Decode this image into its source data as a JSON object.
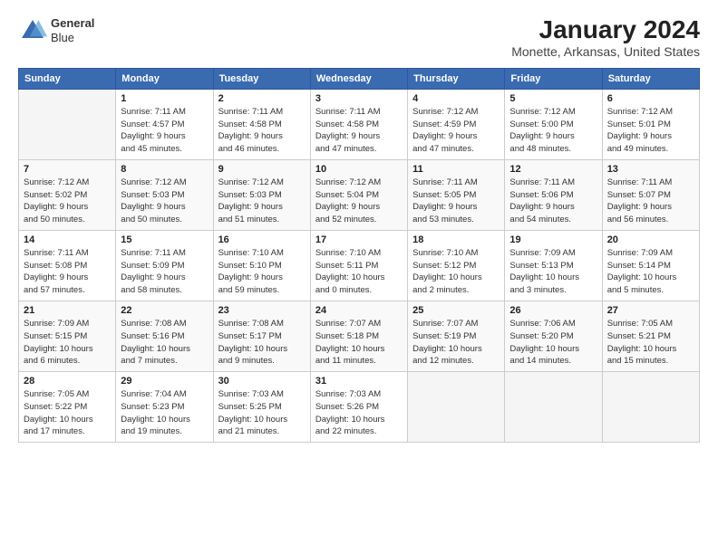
{
  "header": {
    "logo": {
      "line1": "General",
      "line2": "Blue"
    },
    "title": "January 2024",
    "subtitle": "Monette, Arkansas, United States"
  },
  "calendar": {
    "days_of_week": [
      "Sunday",
      "Monday",
      "Tuesday",
      "Wednesday",
      "Thursday",
      "Friday",
      "Saturday"
    ],
    "weeks": [
      [
        {
          "day": "",
          "info": ""
        },
        {
          "day": "1",
          "info": "Sunrise: 7:11 AM\nSunset: 4:57 PM\nDaylight: 9 hours\nand 45 minutes."
        },
        {
          "day": "2",
          "info": "Sunrise: 7:11 AM\nSunset: 4:58 PM\nDaylight: 9 hours\nand 46 minutes."
        },
        {
          "day": "3",
          "info": "Sunrise: 7:11 AM\nSunset: 4:58 PM\nDaylight: 9 hours\nand 47 minutes."
        },
        {
          "day": "4",
          "info": "Sunrise: 7:12 AM\nSunset: 4:59 PM\nDaylight: 9 hours\nand 47 minutes."
        },
        {
          "day": "5",
          "info": "Sunrise: 7:12 AM\nSunset: 5:00 PM\nDaylight: 9 hours\nand 48 minutes."
        },
        {
          "day": "6",
          "info": "Sunrise: 7:12 AM\nSunset: 5:01 PM\nDaylight: 9 hours\nand 49 minutes."
        }
      ],
      [
        {
          "day": "7",
          "info": "Sunrise: 7:12 AM\nSunset: 5:02 PM\nDaylight: 9 hours\nand 50 minutes."
        },
        {
          "day": "8",
          "info": "Sunrise: 7:12 AM\nSunset: 5:03 PM\nDaylight: 9 hours\nand 50 minutes."
        },
        {
          "day": "9",
          "info": "Sunrise: 7:12 AM\nSunset: 5:03 PM\nDaylight: 9 hours\nand 51 minutes."
        },
        {
          "day": "10",
          "info": "Sunrise: 7:12 AM\nSunset: 5:04 PM\nDaylight: 9 hours\nand 52 minutes."
        },
        {
          "day": "11",
          "info": "Sunrise: 7:11 AM\nSunset: 5:05 PM\nDaylight: 9 hours\nand 53 minutes."
        },
        {
          "day": "12",
          "info": "Sunrise: 7:11 AM\nSunset: 5:06 PM\nDaylight: 9 hours\nand 54 minutes."
        },
        {
          "day": "13",
          "info": "Sunrise: 7:11 AM\nSunset: 5:07 PM\nDaylight: 9 hours\nand 56 minutes."
        }
      ],
      [
        {
          "day": "14",
          "info": "Sunrise: 7:11 AM\nSunset: 5:08 PM\nDaylight: 9 hours\nand 57 minutes."
        },
        {
          "day": "15",
          "info": "Sunrise: 7:11 AM\nSunset: 5:09 PM\nDaylight: 9 hours\nand 58 minutes."
        },
        {
          "day": "16",
          "info": "Sunrise: 7:10 AM\nSunset: 5:10 PM\nDaylight: 9 hours\nand 59 minutes."
        },
        {
          "day": "17",
          "info": "Sunrise: 7:10 AM\nSunset: 5:11 PM\nDaylight: 10 hours\nand 0 minutes."
        },
        {
          "day": "18",
          "info": "Sunrise: 7:10 AM\nSunset: 5:12 PM\nDaylight: 10 hours\nand 2 minutes."
        },
        {
          "day": "19",
          "info": "Sunrise: 7:09 AM\nSunset: 5:13 PM\nDaylight: 10 hours\nand 3 minutes."
        },
        {
          "day": "20",
          "info": "Sunrise: 7:09 AM\nSunset: 5:14 PM\nDaylight: 10 hours\nand 5 minutes."
        }
      ],
      [
        {
          "day": "21",
          "info": "Sunrise: 7:09 AM\nSunset: 5:15 PM\nDaylight: 10 hours\nand 6 minutes."
        },
        {
          "day": "22",
          "info": "Sunrise: 7:08 AM\nSunset: 5:16 PM\nDaylight: 10 hours\nand 7 minutes."
        },
        {
          "day": "23",
          "info": "Sunrise: 7:08 AM\nSunset: 5:17 PM\nDaylight: 10 hours\nand 9 minutes."
        },
        {
          "day": "24",
          "info": "Sunrise: 7:07 AM\nSunset: 5:18 PM\nDaylight: 10 hours\nand 11 minutes."
        },
        {
          "day": "25",
          "info": "Sunrise: 7:07 AM\nSunset: 5:19 PM\nDaylight: 10 hours\nand 12 minutes."
        },
        {
          "day": "26",
          "info": "Sunrise: 7:06 AM\nSunset: 5:20 PM\nDaylight: 10 hours\nand 14 minutes."
        },
        {
          "day": "27",
          "info": "Sunrise: 7:05 AM\nSunset: 5:21 PM\nDaylight: 10 hours\nand 15 minutes."
        }
      ],
      [
        {
          "day": "28",
          "info": "Sunrise: 7:05 AM\nSunset: 5:22 PM\nDaylight: 10 hours\nand 17 minutes."
        },
        {
          "day": "29",
          "info": "Sunrise: 7:04 AM\nSunset: 5:23 PM\nDaylight: 10 hours\nand 19 minutes."
        },
        {
          "day": "30",
          "info": "Sunrise: 7:03 AM\nSunset: 5:25 PM\nDaylight: 10 hours\nand 21 minutes."
        },
        {
          "day": "31",
          "info": "Sunrise: 7:03 AM\nSunset: 5:26 PM\nDaylight: 10 hours\nand 22 minutes."
        },
        {
          "day": "",
          "info": ""
        },
        {
          "day": "",
          "info": ""
        },
        {
          "day": "",
          "info": ""
        }
      ]
    ]
  }
}
